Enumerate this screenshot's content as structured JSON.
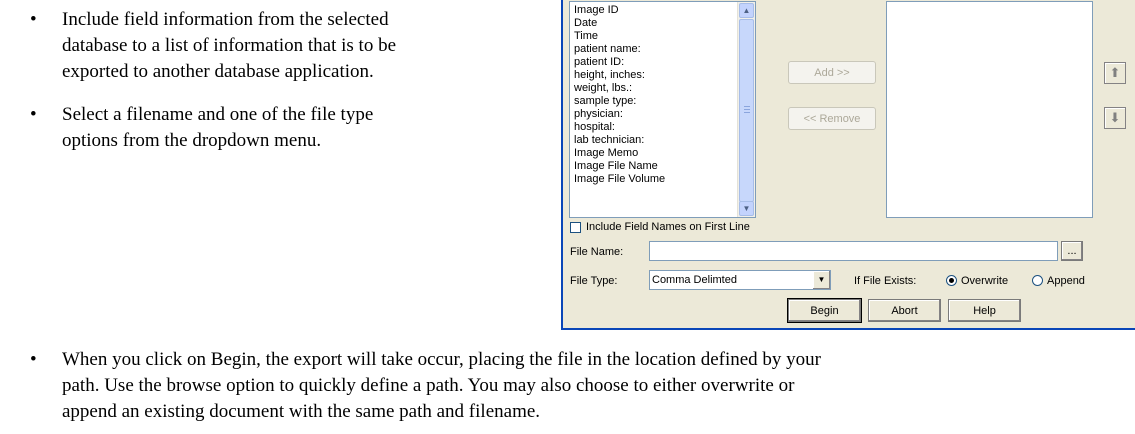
{
  "bullets": [
    "Include field information from the selected database to a list of information that is to be exported to another database application.",
    "Select a filename and one of the file type options from the dropdown menu.",
    "When you click on Begin, the export will take occur, placing the file in the location defined by your path.  Use the browse option to quickly define a path.  You may also choose to either overwrite or append an existing document with the same path and filename."
  ],
  "bullet_lines": {
    "b1": [
      "Include field information from the selected",
      "database to a list of information that is to be",
      "exported to another database application."
    ],
    "b2": [
      "Select a filename and one of the file type",
      "options from the dropdown menu."
    ],
    "b3": [
      "When you click on Begin, the export will take occur, placing the file in the location defined by your",
      "path.  Use the browse option to quickly define a path.  You may also choose to either overwrite or",
      "append an existing document with the same path and filename."
    ]
  },
  "bullet_glyph": "•",
  "dialog": {
    "available_fields": [
      "Image ID",
      "Date",
      "Time",
      "patient name:",
      "patient ID:",
      "height, inches:",
      "weight, lbs.:",
      "sample type:",
      "physician:",
      "hospital:",
      "lab technician:",
      "Image Memo",
      "Image File Name",
      "Image File Volume"
    ],
    "selected_fields": [],
    "add_label": "Add >>",
    "remove_label": "<< Remove",
    "include_field_names_label": "Include Field Names on First Line",
    "include_field_names_checked": false,
    "file_name_label": "File Name:",
    "file_name_value": "",
    "browse_label": "...",
    "file_type_label": "File Type:",
    "file_type_value": "Comma Delimted",
    "if_exists_label": "If File Exists:",
    "overwrite_label": "Overwrite",
    "append_label": "Append",
    "if_exists_selected": "Overwrite",
    "begin_label": "Begin",
    "abort_label": "Abort",
    "help_label": "Help"
  },
  "colors": {
    "dialog_bg": "#ece9d8",
    "frame_blue": "#0a46b8",
    "scroll_blue": "#c3d3fd"
  }
}
